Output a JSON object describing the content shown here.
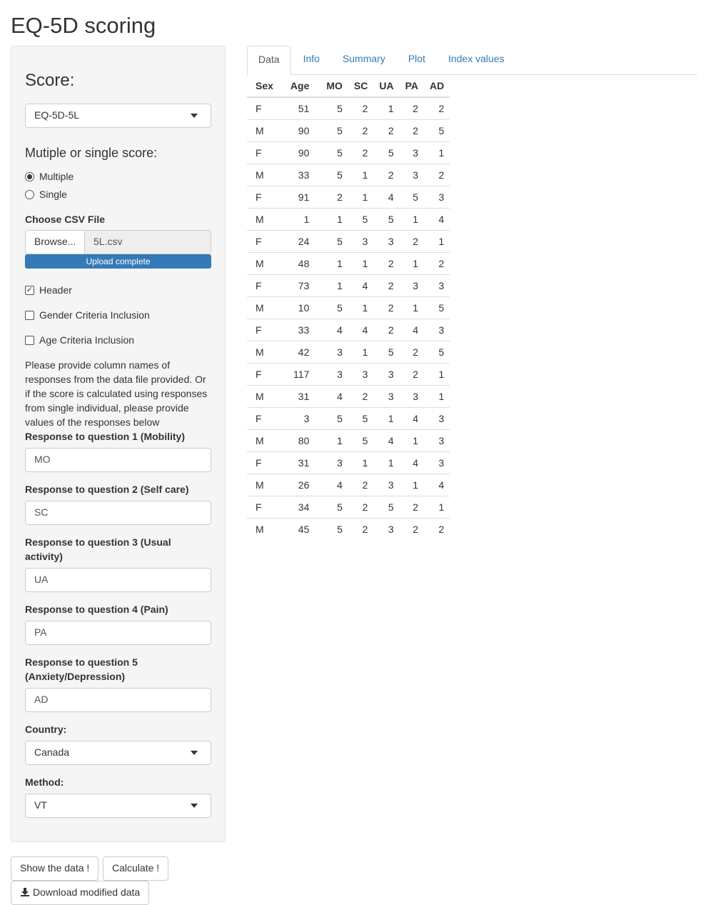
{
  "title": "EQ-5D scoring",
  "sidebar": {
    "score_label": "Score:",
    "score_value": "EQ-5D-5L",
    "mode_label": "Mutiple or single score:",
    "mode_options": [
      "Multiple",
      "Single"
    ],
    "mode_selected": "Multiple",
    "file_label": "Choose CSV File",
    "browse_label": "Browse...",
    "file_name": "5L.csv",
    "upload_status": "Upload complete",
    "header_label": "Header",
    "header_checked": true,
    "gender_label": "Gender Criteria Inclusion",
    "gender_checked": false,
    "age_label": "Age Criteria Inclusion",
    "age_checked": false,
    "help_text": "Please provide column names of responses from the data file provided. Or if the score is calculated using responses from single individual, please provide values of the responses below",
    "q1_label": "Response to question 1 (Mobility)",
    "q1_value": "MO",
    "q2_label": "Response to question 2 (Self care)",
    "q2_value": "SC",
    "q3_label": "Response to question 3 (Usual activity)",
    "q3_value": "UA",
    "q4_label": "Response to question 4 (Pain)",
    "q4_value": "PA",
    "q5_label": "Response to question 5 (Anxiety/Depression)",
    "q5_value": "AD",
    "country_label": "Country:",
    "country_value": "Canada",
    "method_label": "Method:",
    "method_value": "VT"
  },
  "buttons": {
    "show_data": "Show the data !",
    "calculate": "Calculate !",
    "download": "Download modified data"
  },
  "tabs": [
    "Data",
    "Info",
    "Summary",
    "Plot",
    "Index values"
  ],
  "active_tab": "Data",
  "table": {
    "columns": [
      "Sex",
      "Age",
      "MO",
      "SC",
      "UA",
      "PA",
      "AD"
    ],
    "rows": [
      [
        "F",
        "51",
        "5",
        "2",
        "1",
        "2",
        "2"
      ],
      [
        "M",
        "90",
        "5",
        "2",
        "2",
        "2",
        "5"
      ],
      [
        "F",
        "90",
        "5",
        "2",
        "5",
        "3",
        "1"
      ],
      [
        "M",
        "33",
        "5",
        "1",
        "2",
        "3",
        "2"
      ],
      [
        "F",
        "91",
        "2",
        "1",
        "4",
        "5",
        "3"
      ],
      [
        "M",
        "1",
        "1",
        "5",
        "5",
        "1",
        "4"
      ],
      [
        "F",
        "24",
        "5",
        "3",
        "3",
        "2",
        "1"
      ],
      [
        "M",
        "48",
        "1",
        "1",
        "2",
        "1",
        "2"
      ],
      [
        "F",
        "73",
        "1",
        "4",
        "2",
        "3",
        "3"
      ],
      [
        "M",
        "10",
        "5",
        "1",
        "2",
        "1",
        "5"
      ],
      [
        "F",
        "33",
        "4",
        "4",
        "2",
        "4",
        "3"
      ],
      [
        "M",
        "42",
        "3",
        "1",
        "5",
        "2",
        "5"
      ],
      [
        "F",
        "117",
        "3",
        "3",
        "3",
        "2",
        "1"
      ],
      [
        "M",
        "31",
        "4",
        "2",
        "3",
        "3",
        "1"
      ],
      [
        "F",
        "3",
        "5",
        "5",
        "1",
        "4",
        "3"
      ],
      [
        "M",
        "80",
        "1",
        "5",
        "4",
        "1",
        "3"
      ],
      [
        "F",
        "31",
        "3",
        "1",
        "1",
        "4",
        "3"
      ],
      [
        "M",
        "26",
        "4",
        "2",
        "3",
        "1",
        "4"
      ],
      [
        "F",
        "34",
        "5",
        "2",
        "5",
        "2",
        "1"
      ],
      [
        "M",
        "45",
        "5",
        "2",
        "3",
        "2",
        "2"
      ]
    ]
  },
  "colors": {
    "accent": "#337ab7",
    "sidebar_bg": "#f5f5f5"
  }
}
